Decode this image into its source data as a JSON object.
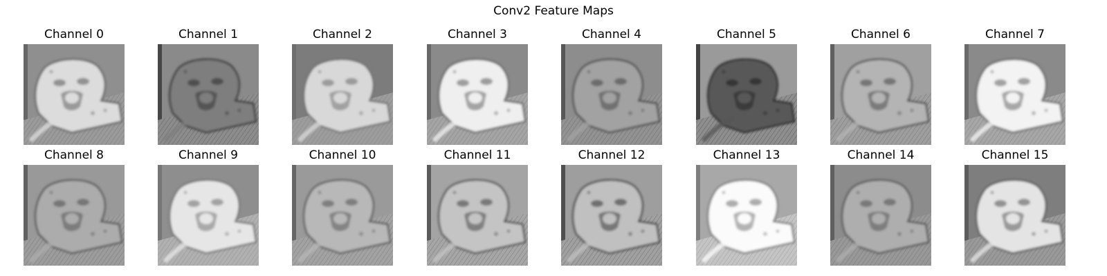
{
  "figure": {
    "title": "Conv2 Feature Maps"
  },
  "panels": [
    {
      "title": "Channel 0",
      "image": "feature-map-channel-0",
      "tone": {
        "bg": "#8f8f8f",
        "body": "#dcdcdc",
        "edge": "#555555",
        "ground": "#9a9a9a"
      }
    },
    {
      "title": "Channel 1",
      "image": "feature-map-channel-1",
      "tone": {
        "bg": "#8a8a8a",
        "body": "#7e7e7e",
        "edge": "#2a2a2a",
        "ground": "#8c8c8c"
      }
    },
    {
      "title": "Channel 2",
      "image": "feature-map-channel-2",
      "tone": {
        "bg": "#7c7c7c",
        "body": "#d8d8d8",
        "edge": "#6a6a6a",
        "ground": "#9c9c9c"
      }
    },
    {
      "title": "Channel 3",
      "image": "feature-map-channel-3",
      "tone": {
        "bg": "#8a8a8a",
        "body": "#efefef",
        "edge": "#5a5a5a",
        "ground": "#a4a4a4"
      }
    },
    {
      "title": "Channel 4",
      "image": "feature-map-channel-4",
      "tone": {
        "bg": "#8d8d8d",
        "body": "#a2a2a2",
        "edge": "#404040",
        "ground": "#929292"
      }
    },
    {
      "title": "Channel 5",
      "image": "feature-map-channel-5",
      "tone": {
        "bg": "#9a9a9a",
        "body": "#585858",
        "edge": "#1c1c1c",
        "ground": "#8e8e8e"
      }
    },
    {
      "title": "Channel 6",
      "image": "feature-map-channel-6",
      "tone": {
        "bg": "#a0a0a0",
        "body": "#b4b4b4",
        "edge": "#444444",
        "ground": "#9e9e9e"
      }
    },
    {
      "title": "Channel 7",
      "image": "feature-map-channel-7",
      "tone": {
        "bg": "#8a8a8a",
        "body": "#f3f3f3",
        "edge": "#5c5c5c",
        "ground": "#a6a6a6"
      }
    },
    {
      "title": "Channel 8",
      "image": "feature-map-channel-8",
      "tone": {
        "bg": "#999999",
        "body": "#acacac",
        "edge": "#4a4a4a",
        "ground": "#9c9c9c"
      }
    },
    {
      "title": "Channel 9",
      "image": "feature-map-channel-9",
      "tone": {
        "bg": "#8e8e8e",
        "body": "#e6e6e6",
        "edge": "#6c6c6c",
        "ground": "#b0b0b0"
      }
    },
    {
      "title": "Channel 10",
      "image": "feature-map-channel-10",
      "tone": {
        "bg": "#9a9a9a",
        "body": "#b8b8b8",
        "edge": "#505050",
        "ground": "#a2a2a2"
      }
    },
    {
      "title": "Channel 11",
      "image": "feature-map-channel-11",
      "tone": {
        "bg": "#a4a4a4",
        "body": "#c4c4c4",
        "edge": "#3c3c3c",
        "ground": "#a6a6a6"
      }
    },
    {
      "title": "Channel 12",
      "image": "feature-map-channel-12",
      "tone": {
        "bg": "#9e9e9e",
        "body": "#c0c0c0",
        "edge": "#2e2e2e",
        "ground": "#a0a0a0"
      }
    },
    {
      "title": "Channel 13",
      "image": "feature-map-channel-13",
      "tone": {
        "bg": "#a8a8a8",
        "body": "#fbfbfb",
        "edge": "#6e6e6e",
        "ground": "#c4c4c4"
      }
    },
    {
      "title": "Channel 14",
      "image": "feature-map-channel-14",
      "tone": {
        "bg": "#8c8c8c",
        "body": "#aeaeae",
        "edge": "#4c4c4c",
        "ground": "#989898"
      }
    },
    {
      "title": "Channel 15",
      "image": "feature-map-channel-15",
      "tone": {
        "bg": "#7e7e7e",
        "body": "#e4e4e4",
        "edge": "#4e4e4e",
        "ground": "#999999"
      }
    }
  ]
}
